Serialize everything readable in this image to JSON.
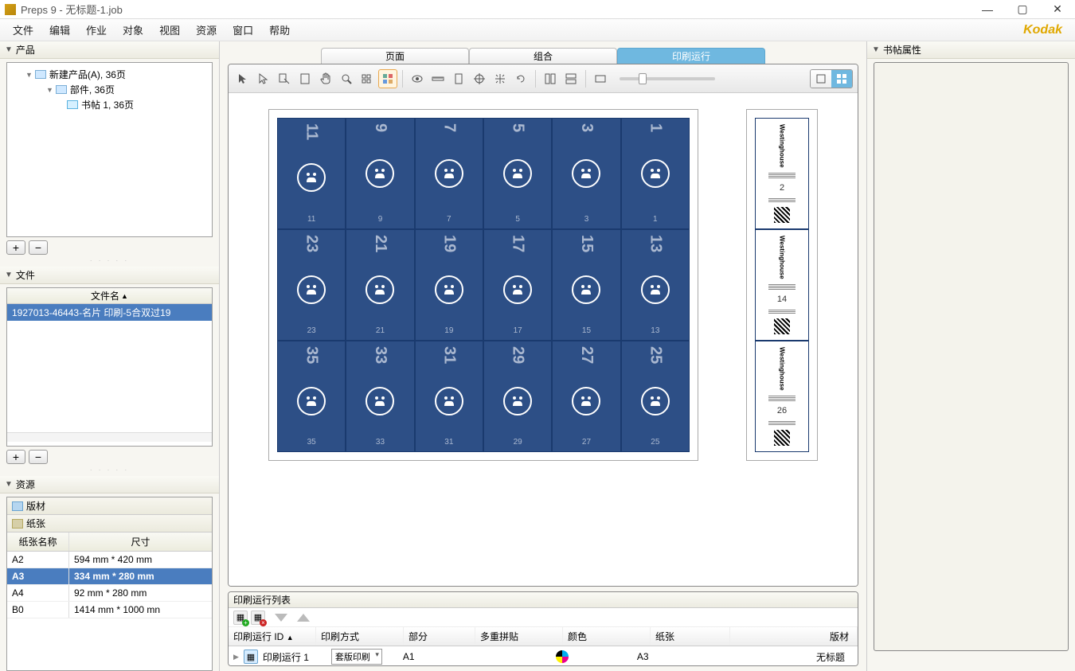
{
  "title": "Preps 9 - 无标题-1.job",
  "menus": [
    "文件",
    "编辑",
    "作业",
    "对象",
    "视图",
    "资源",
    "窗口",
    "帮助"
  ],
  "brand": "Kodak",
  "left": {
    "products_head": "产品",
    "tree": {
      "root": "新建产品(A), 36页",
      "part": "部件, 36页",
      "sig": "书帖 1, 36页"
    },
    "files_head": "文件",
    "files_col": "文件名",
    "file_row": "1927013-46443-名片 印刷-5合双过19",
    "resources_head": "资源",
    "res_tab1": "版材",
    "res_tab2": "纸张",
    "paper_cols": {
      "name": "纸张名称",
      "size": "尺寸"
    },
    "papers": [
      {
        "name": "A2",
        "size": "594 mm * 420 mm"
      },
      {
        "name": "A3",
        "size": "334 mm * 280 mm",
        "selected": true
      },
      {
        "name": "A4",
        "size": "92 mm * 280 mm"
      },
      {
        "name": "B0",
        "size": "1414 mm * 1000 mn"
      }
    ]
  },
  "center": {
    "tabs": [
      "页面",
      "组合",
      "印刷运行"
    ],
    "front_rows": [
      {
        "top": [
          "11",
          "9",
          "7",
          "5",
          "3",
          "1"
        ],
        "bot": [
          "11",
          "9",
          "7",
          "5",
          "3",
          "1"
        ]
      },
      {
        "top": [
          "23",
          "21",
          "19",
          "17",
          "15",
          "13"
        ],
        "bot": [
          "23",
          "21",
          "19",
          "17",
          "15",
          "13"
        ]
      },
      {
        "top": [
          "35",
          "33",
          "31",
          "29",
          "27",
          "25"
        ],
        "bot": [
          "35",
          "33",
          "31",
          "29",
          "27",
          "25"
        ]
      }
    ],
    "back_rows": [
      {
        "num": "2",
        "brand": "Westinghouse"
      },
      {
        "num": "14",
        "brand": "Westinghouse"
      },
      {
        "num": "26",
        "brand": "Westinghouse"
      }
    ],
    "runlist_head": "印刷运行列表",
    "rl_cols": {
      "id": "印刷运行 ID",
      "method": "印刷方式",
      "part": "部分",
      "multi": "多重拼贴",
      "color": "颜色",
      "paper": "纸张",
      "plate": "版材"
    },
    "rl_row": {
      "id": "印刷运行 1",
      "method": "套版印刷",
      "part": "A1",
      "paper": "A3",
      "plate": "无标题"
    }
  },
  "right": {
    "head": "书帖属性"
  }
}
